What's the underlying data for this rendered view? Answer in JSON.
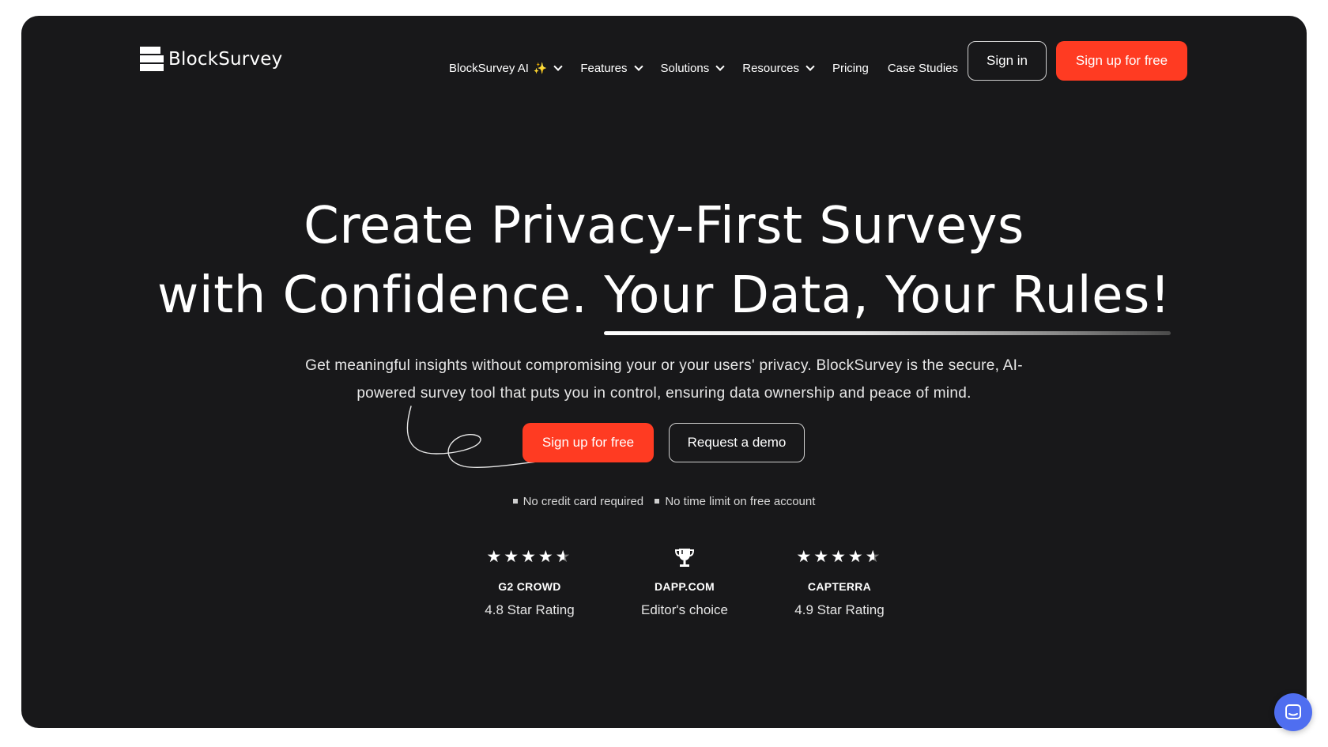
{
  "brand": {
    "name": "BlockSurvey"
  },
  "nav": {
    "items": [
      {
        "label": "BlockSurvey AI",
        "has_sparkle": true,
        "has_dropdown": true
      },
      {
        "label": "Features",
        "has_dropdown": true
      },
      {
        "label": "Solutions",
        "has_dropdown": true
      },
      {
        "label": "Resources",
        "has_dropdown": true
      },
      {
        "label": "Pricing",
        "has_dropdown": false
      },
      {
        "label": "Case Studies",
        "has_dropdown": false
      }
    ],
    "sign_in": "Sign in",
    "sign_up": "Sign up for free"
  },
  "hero": {
    "headline_line1": "Create Privacy-First Surveys",
    "headline_line2_plain": "with Confidence. ",
    "headline_line2_highlight": "Your Data, Your Rules!",
    "subtitle": "Get meaningful insights without compromising your or your users' privacy. BlockSurvey is the secure, AI-powered survey tool that puts you in control, ensuring data ownership and peace of mind.",
    "cta_primary": "Sign up for free",
    "cta_secondary": "Request a demo",
    "notes": [
      "No credit card required",
      "No time limit on free account"
    ]
  },
  "ratings": [
    {
      "source": "G2 CROWD",
      "label": "4.8 Star Rating",
      "icon": "stars-icon",
      "stars": 4.5
    },
    {
      "source": "DAPP.COM",
      "label": "Editor's choice",
      "icon": "trophy-icon"
    },
    {
      "source": "CAPTERRA",
      "label": "4.9 Star Rating",
      "icon": "stars-icon",
      "stars": 4.5
    }
  ],
  "colors": {
    "background": "#18181a",
    "accent": "#ff3b22",
    "chat": "#4f6ef0"
  }
}
